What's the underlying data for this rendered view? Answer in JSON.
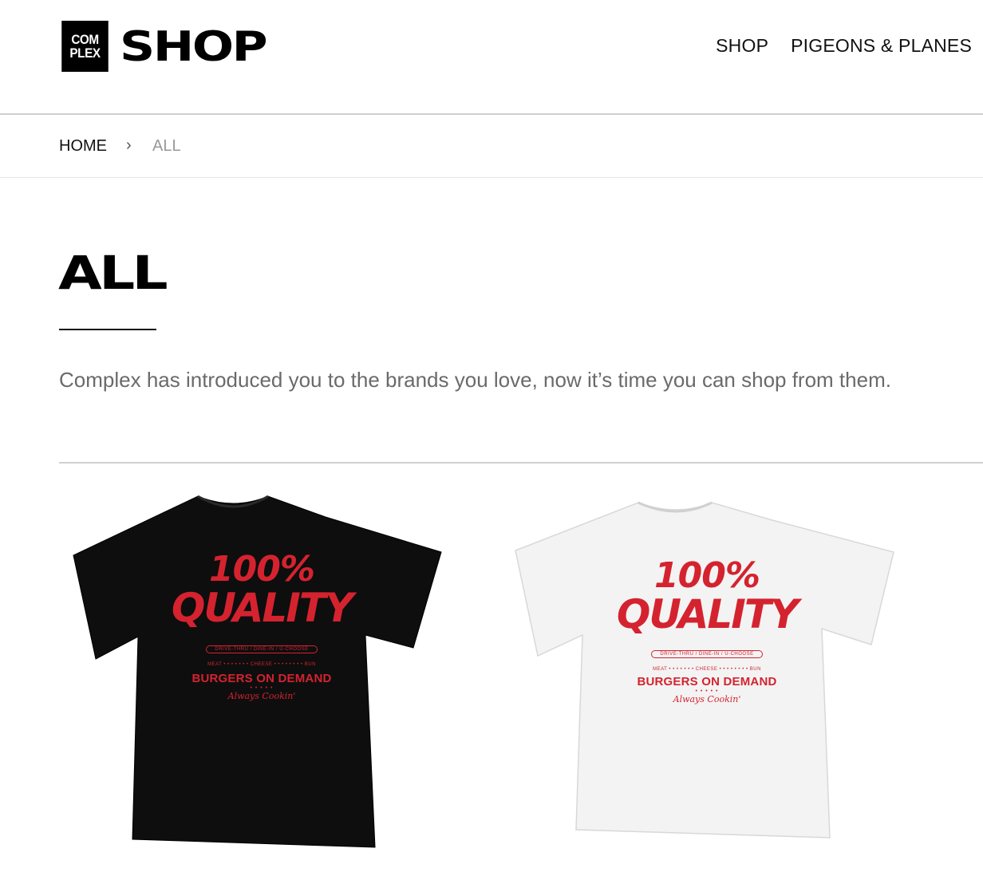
{
  "header": {
    "logo_top": "COM",
    "logo_bottom": "PLEX",
    "logo_word": "SHOP",
    "nav": [
      {
        "label": "SHOP"
      },
      {
        "label": "PIGEONS & PLANES"
      }
    ]
  },
  "breadcrumb": {
    "home": "HOME",
    "separator": "›",
    "current": "ALL"
  },
  "page": {
    "title": "ALL",
    "intro": "Complex has introduced you to the brands you love, now it’s time you can shop from them."
  },
  "products": [
    {
      "color": "#0e0e0e",
      "print": {
        "line1": "100%",
        "line2": "QUALITY",
        "pill": "DRIVE-THRU / DINE-IN / U-CHOOSE",
        "tiny_row": "MEAT • • • • • • • CHEESE • • • • • • • • BUN",
        "main": "BURGERS ON DEMAND",
        "stars": "• • • • •",
        "sign": "Always Cookin'"
      }
    },
    {
      "color": "#f3f3f3",
      "print": {
        "line1": "100%",
        "line2": "QUALITY",
        "pill": "DRIVE-THRU / DINE-IN / U-CHOOSE",
        "tiny_row": "MEAT • • • • • • • CHEESE • • • • • • • • BUN",
        "main": "BURGERS ON DEMAND",
        "stars": "• • • • •",
        "sign": "Always Cookin'"
      }
    }
  ],
  "colors": {
    "print_red": "#d4232f",
    "muted_text": "#6a6a6a"
  }
}
